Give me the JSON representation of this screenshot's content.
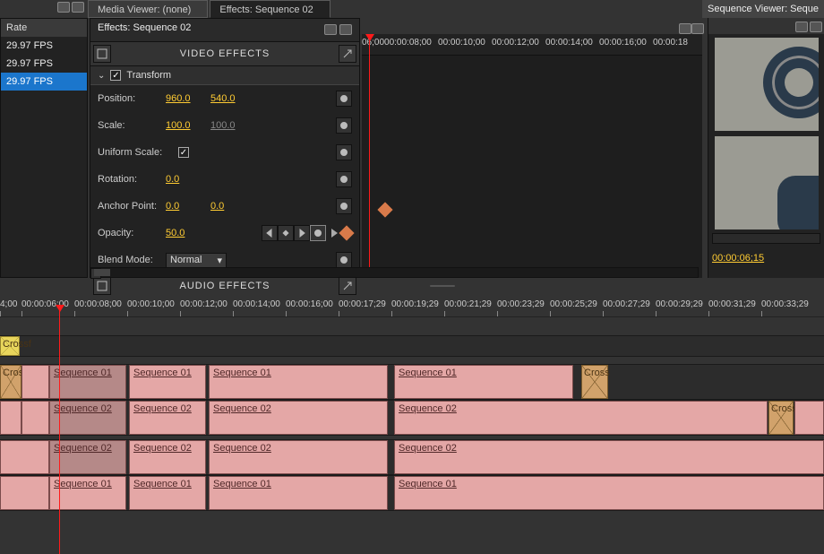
{
  "tabs": {
    "media_viewer": "Media Viewer: (none)",
    "effects": "Effects: Sequence 02",
    "sequence_viewer": "Sequence Viewer: Seque"
  },
  "effects_header": "Effects: Sequence 02",
  "rate": {
    "header": "Rate",
    "rows": [
      "29.97 FPS",
      "29.97 FPS",
      "29.97 FPS"
    ],
    "selected_index": 2
  },
  "video_effects_title": "VIDEO EFFECTS",
  "audio_effects_title": "AUDIO EFFECTS",
  "transform": {
    "title": "Transform",
    "position_label": "Position:",
    "position_x": "960.0",
    "position_y": "540.0",
    "scale_label": "Scale:",
    "scale_x": "100.0",
    "scale_y": "100.0",
    "uniform_scale_label": "Uniform Scale:",
    "uniform_scale_checked": true,
    "rotation_label": "Rotation:",
    "rotation_val": "0.0",
    "anchor_label": "Anchor Point:",
    "anchor_x": "0.0",
    "anchor_y": "0.0",
    "opacity_label": "Opacity:",
    "opacity_val": "50.0",
    "blend_label": "Blend Mode:",
    "blend_mode": "Normal"
  },
  "fx_ruler": [
    "06;00",
    "00:00:08;00",
    "00:00:10;00",
    "00:00:12;00",
    "00:00:14;00",
    "00:00:16;00",
    "00:00:18"
  ],
  "viewer": {
    "timecode": "00:00:06;15"
  },
  "tl_ruler": [
    "4;00",
    "00:00:06;00",
    "00:00:08;00",
    "00:00:10;00",
    "00:00:12;00",
    "00:00:14;00",
    "00:00:16;00",
    "00:00:17;29",
    "00:00:19;29",
    "00:00:21;29",
    "00:00:23;29",
    "00:00:25;29",
    "00:00:27;29",
    "00:00:29;29",
    "00:00:31;29",
    "00:00:33;29"
  ],
  "clips": {
    "seq01": "Sequence 01",
    "seq02": "Sequence 02",
    "cross": "Cross",
    "crossf": "Crossf"
  }
}
